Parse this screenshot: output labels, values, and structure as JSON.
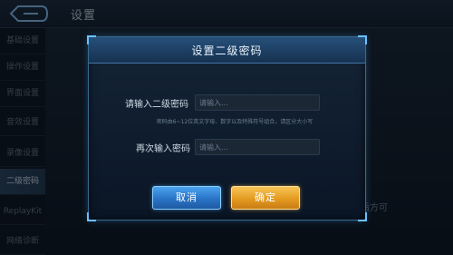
{
  "header": {
    "title": "设置"
  },
  "sidebar": {
    "items": [
      {
        "label": "基础设置"
      },
      {
        "label": "操作设置"
      },
      {
        "label": "界面设置"
      },
      {
        "label": "音效设置"
      },
      {
        "label": "录像设置"
      },
      {
        "label": "二级密码"
      },
      {
        "label": "ReplayKit"
      },
      {
        "label": "网络诊断"
      }
    ],
    "active_index": 5
  },
  "background": {
    "partial_text": "后方可"
  },
  "dialog": {
    "title": "设置二级密码",
    "password_label": "请输入二级密码",
    "password_placeholder": "请输入...",
    "hint": "密码由6~12位英文字母、数字以及特殊符号组合，请区分大小写",
    "confirm_label": "再次输入密码",
    "confirm_placeholder": "请输入...",
    "cancel_button": "取消",
    "ok_button": "确定"
  },
  "colors": {
    "accent_blue": "#2a73c6",
    "accent_gold": "#e49b22",
    "panel_border": "#3a6a8e"
  },
  "icons": {
    "back": "back-arrow-icon"
  }
}
